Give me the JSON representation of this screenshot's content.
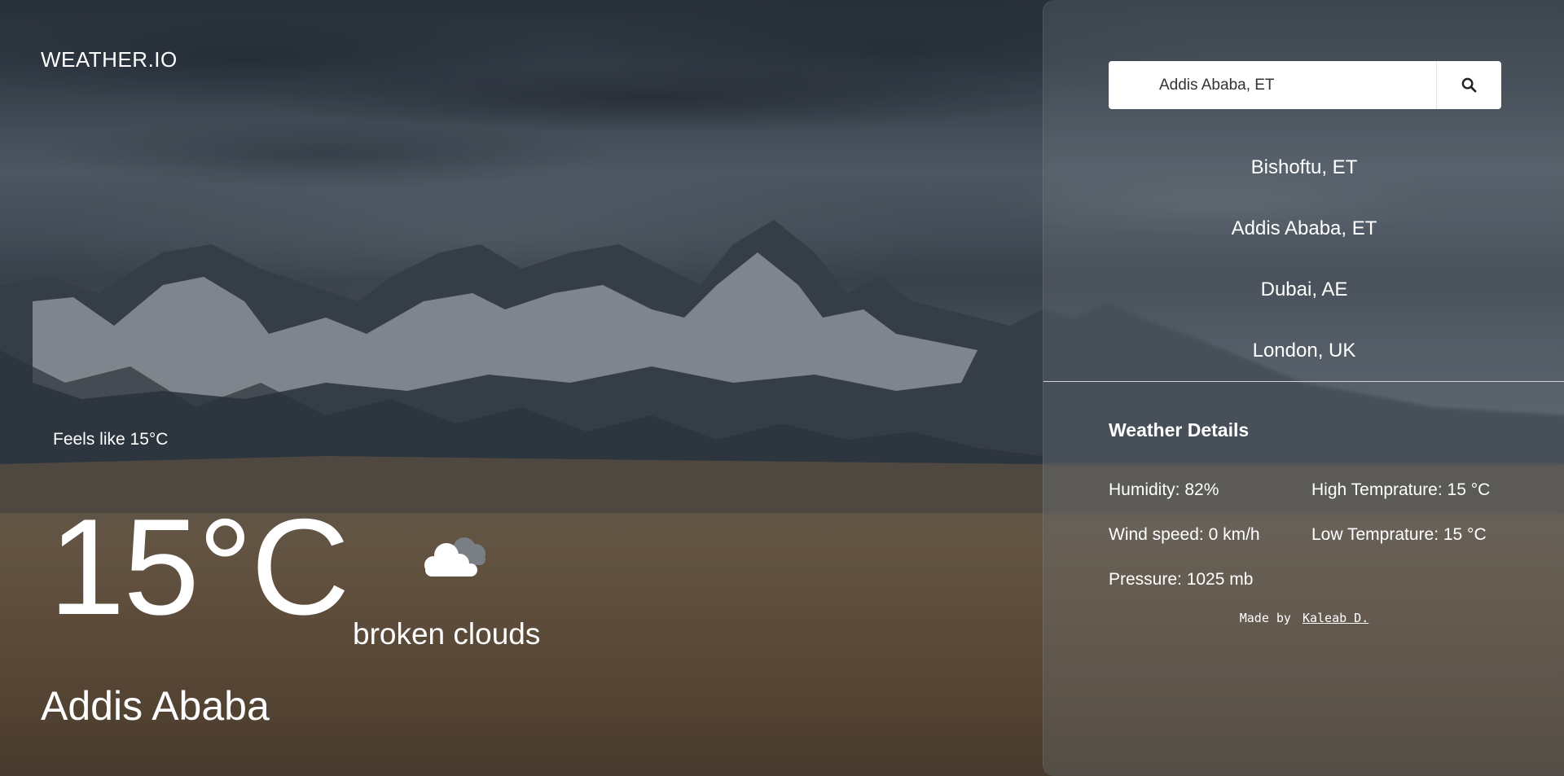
{
  "app": {
    "title": "WEATHER.IO"
  },
  "current": {
    "feels_like": "Feels like 15°C",
    "temperature": "15°C",
    "condition": "broken clouds",
    "condition_icon": "broken-clouds-icon",
    "city": "Addis Ababa"
  },
  "search": {
    "value": "Addis Ababa, ET",
    "icon": "search-icon"
  },
  "recent_locations": [
    {
      "label": "Bishoftu, ET"
    },
    {
      "label": "Addis Ababa, ET"
    },
    {
      "label": "Dubai, AE"
    },
    {
      "label": "London, UK"
    }
  ],
  "details": {
    "title": "Weather Details",
    "humidity": "Humidity: 82%",
    "high": "High Temprature: 15 °C",
    "wind": "Wind speed: 0 km/h",
    "low": "Low Temprature: 15 °C",
    "pressure": "Pressure: 1025 mb"
  },
  "footer": {
    "made_by": "Made by",
    "author": "Kaleab D."
  }
}
